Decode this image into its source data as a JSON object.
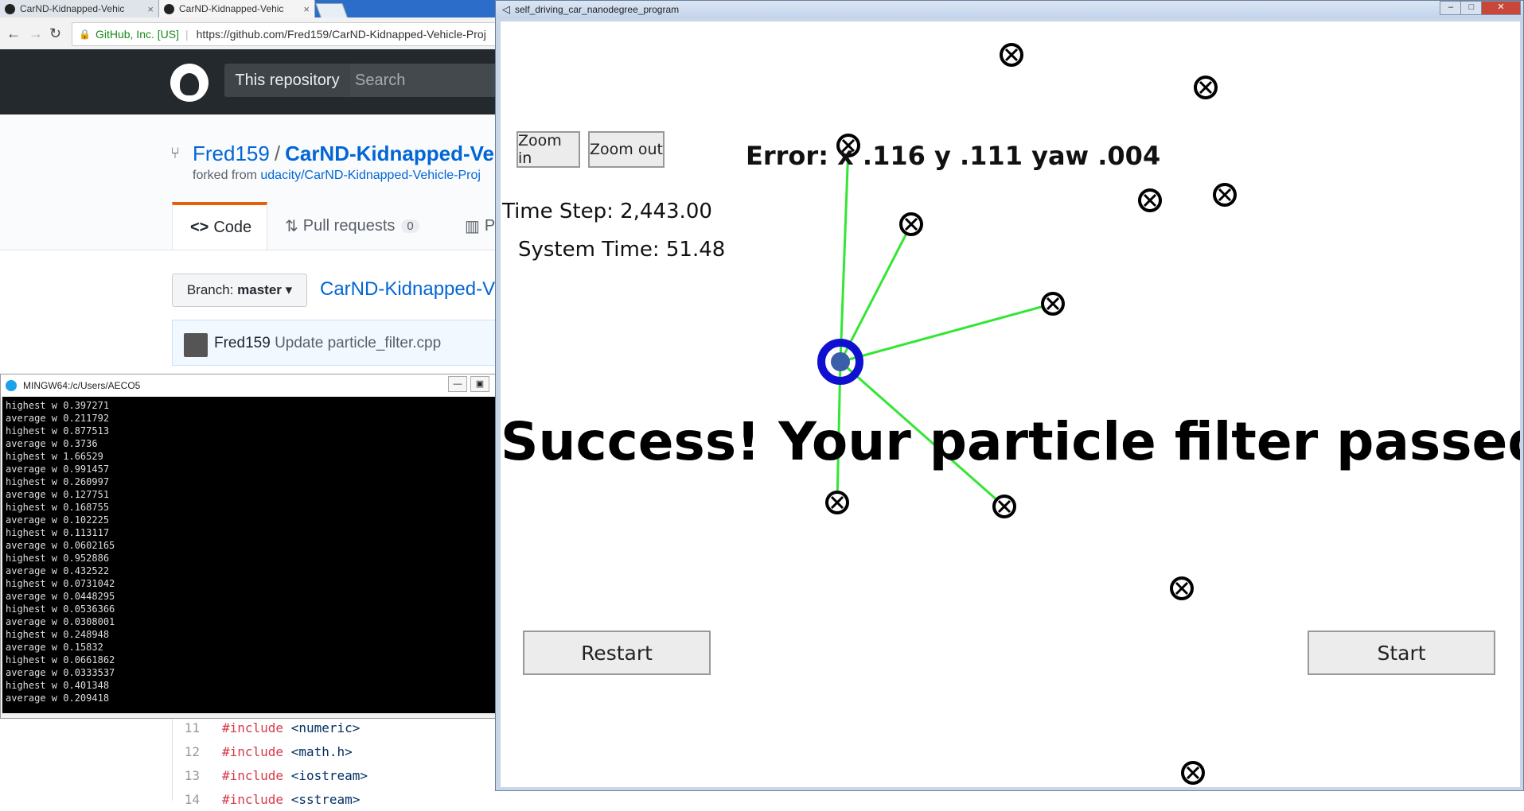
{
  "browser": {
    "tabs": [
      {
        "label": "CarND-Kidnapped-Vehic",
        "close": "×"
      },
      {
        "label": "CarND-Kidnapped-Vehic",
        "close": "×"
      }
    ],
    "cert": "GitHub, Inc. [US]",
    "url": "https://github.com/Fred159/CarND-Kidnapped-Vehicle-Proj",
    "header": {
      "scope": "This repository",
      "search_placeholder": "Search"
    },
    "repo": {
      "owner": "Fred159",
      "separator": "/",
      "name": "CarND-Kidnapped-Ve",
      "forked_prefix": "forked from",
      "forked_link": "udacity/CarND-Kidnapped-Vehicle-Proj"
    },
    "nav": {
      "code": "Code",
      "pulls": "Pull requests",
      "pulls_count": "0",
      "projects_partial": "P"
    },
    "branch_label": "Branch:",
    "branch": "master",
    "repo_link": "CarND-Kidnapped-V",
    "commit": {
      "author": "Fred159",
      "message": "Update particle_filter.cpp"
    },
    "code_lines": [
      {
        "num": "11",
        "kw": "#include",
        "lib": "<numeric>"
      },
      {
        "num": "12",
        "kw": "#include",
        "lib": "<math.h>"
      },
      {
        "num": "13",
        "kw": "#include",
        "lib": "<iostream>"
      },
      {
        "num": "14",
        "kw": "#include",
        "lib": "<sstream>"
      }
    ]
  },
  "terminal": {
    "title": "MINGW64:/c/Users/AECO5",
    "lines": [
      "highest w 0.397271",
      "average w 0.211792",
      "highest w 0.877513",
      "average w 0.3736",
      "highest w 1.66529",
      "average w 0.991457",
      "highest w 0.260997",
      "average w 0.127751",
      "highest w 0.168755",
      "average w 0.102225",
      "highest w 0.113117",
      "average w 0.0602165",
      "highest w 0.952886",
      "average w 0.432522",
      "highest w 0.0731042",
      "average w 0.0448295",
      "highest w 0.0536366",
      "average w 0.0308001",
      "highest w 0.248948",
      "average w 0.15832",
      "highest w 0.0661862",
      "average w 0.0333537",
      "highest w 0.401348",
      "average w 0.209418"
    ]
  },
  "simulator": {
    "title": "self_driving_car_nanodegree_program",
    "zoom_in": "Zoom in",
    "zoom_out": "Zoom out",
    "error": "Error: x .116 y .111 yaw .004",
    "time_step": "Time Step: 2,443.00",
    "system_time": "System Time: 51.48",
    "success": "Success! Your particle filter passed!",
    "restart": "Restart",
    "start": "Start",
    "colors": {
      "car": "#1010d0",
      "observation_line": "#33e633",
      "landmark": "#000000"
    }
  }
}
